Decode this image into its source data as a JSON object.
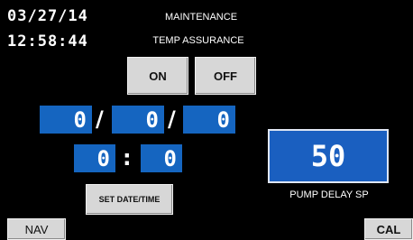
{
  "status": {
    "date": "03/27/14",
    "time": "12:58:44"
  },
  "header": {
    "title": "MAINTENANCE",
    "subtitle": "TEMP ASSURANCE"
  },
  "toggle": {
    "on_label": "ON",
    "off_label": "OFF"
  },
  "date_entry": {
    "month": "0",
    "day": "0",
    "year": "0",
    "separator": "/"
  },
  "time_entry": {
    "hour": "0",
    "minute": "0",
    "separator": ":"
  },
  "set_button_label": "SET DATE/TIME",
  "pump": {
    "value": "50",
    "label": "PUMP DELAY SP"
  },
  "footer": {
    "nav_label": "NAV",
    "cal_label": "CAL"
  },
  "colors": {
    "background": "#000000",
    "field_blue": "#1565c0",
    "button_gray": "#d7d7d7"
  }
}
